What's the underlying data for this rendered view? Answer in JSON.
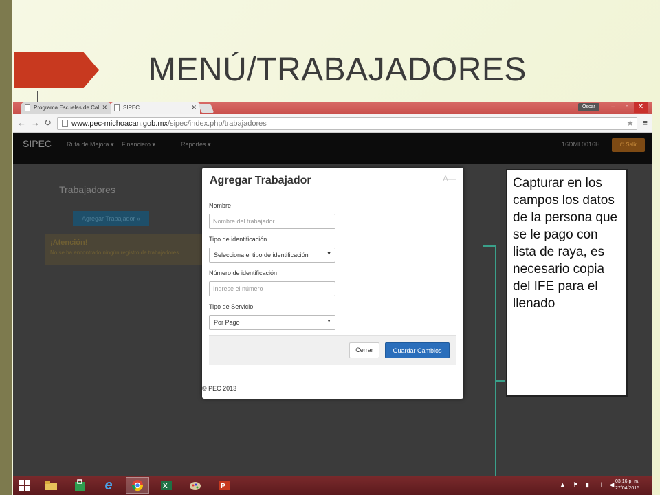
{
  "slide": {
    "title": "MENÚ/TRABAJADORES",
    "callout_text": "Capturar en los campos los datos de la persona que se le pago con lista de raya, es necesario copia del IFE para el llenado"
  },
  "browser": {
    "tabs": [
      {
        "label": "Programa Escuelas de Cal",
        "active": false
      },
      {
        "label": "SIPEC",
        "active": true
      }
    ],
    "user_chip": "Oscar",
    "url_host": "www.pec-michoacan.gob.mx",
    "url_path": "/sipec/index.php/trabajadores"
  },
  "app": {
    "brand": "SIPEC",
    "nav": [
      "Ruta de Mejora ▾",
      "Financiero ▾",
      "Reportes ▾"
    ],
    "school_code": "16DML0016H",
    "logout_label": "Salir",
    "page_heading": "Trabajadores",
    "add_button": "Agregar Trabajador »",
    "alert_title": "¡Atención!",
    "alert_text": "No se ha encontrado ningún registro de trabajadores"
  },
  "modal": {
    "title": "Agregar Trabajador",
    "close_glyph": "A—",
    "fields": {
      "name_label": "Nombre",
      "name_placeholder": "Nombre del trabajador",
      "id_type_label": "Tipo de identificación",
      "id_type_value": "Selecciona el tipo de identificación",
      "id_number_label": "Número de identificación",
      "id_number_placeholder": "Ingrese el número",
      "service_label": "Tipo de Servicio",
      "service_value": "Por Pago"
    },
    "cancel_label": "Cerrar",
    "save_label": "Guardar Cambios",
    "copyright": "© PEC 2013"
  },
  "taskbar": {
    "clock_time": "03:16 p. m.",
    "clock_date": "27/04/2015",
    "apps": [
      {
        "icon": "file-explorer-icon"
      },
      {
        "icon": "store-icon"
      },
      {
        "icon": "internet-explorer-icon"
      },
      {
        "icon": "chrome-icon",
        "active": true
      },
      {
        "icon": "excel-icon"
      },
      {
        "icon": "paint-icon"
      },
      {
        "icon": "powerpoint-icon"
      }
    ]
  },
  "colors": {
    "accent_red": "#c8391f",
    "primary_button": "#2a6ebb",
    "bracket": "#3aa08a"
  }
}
